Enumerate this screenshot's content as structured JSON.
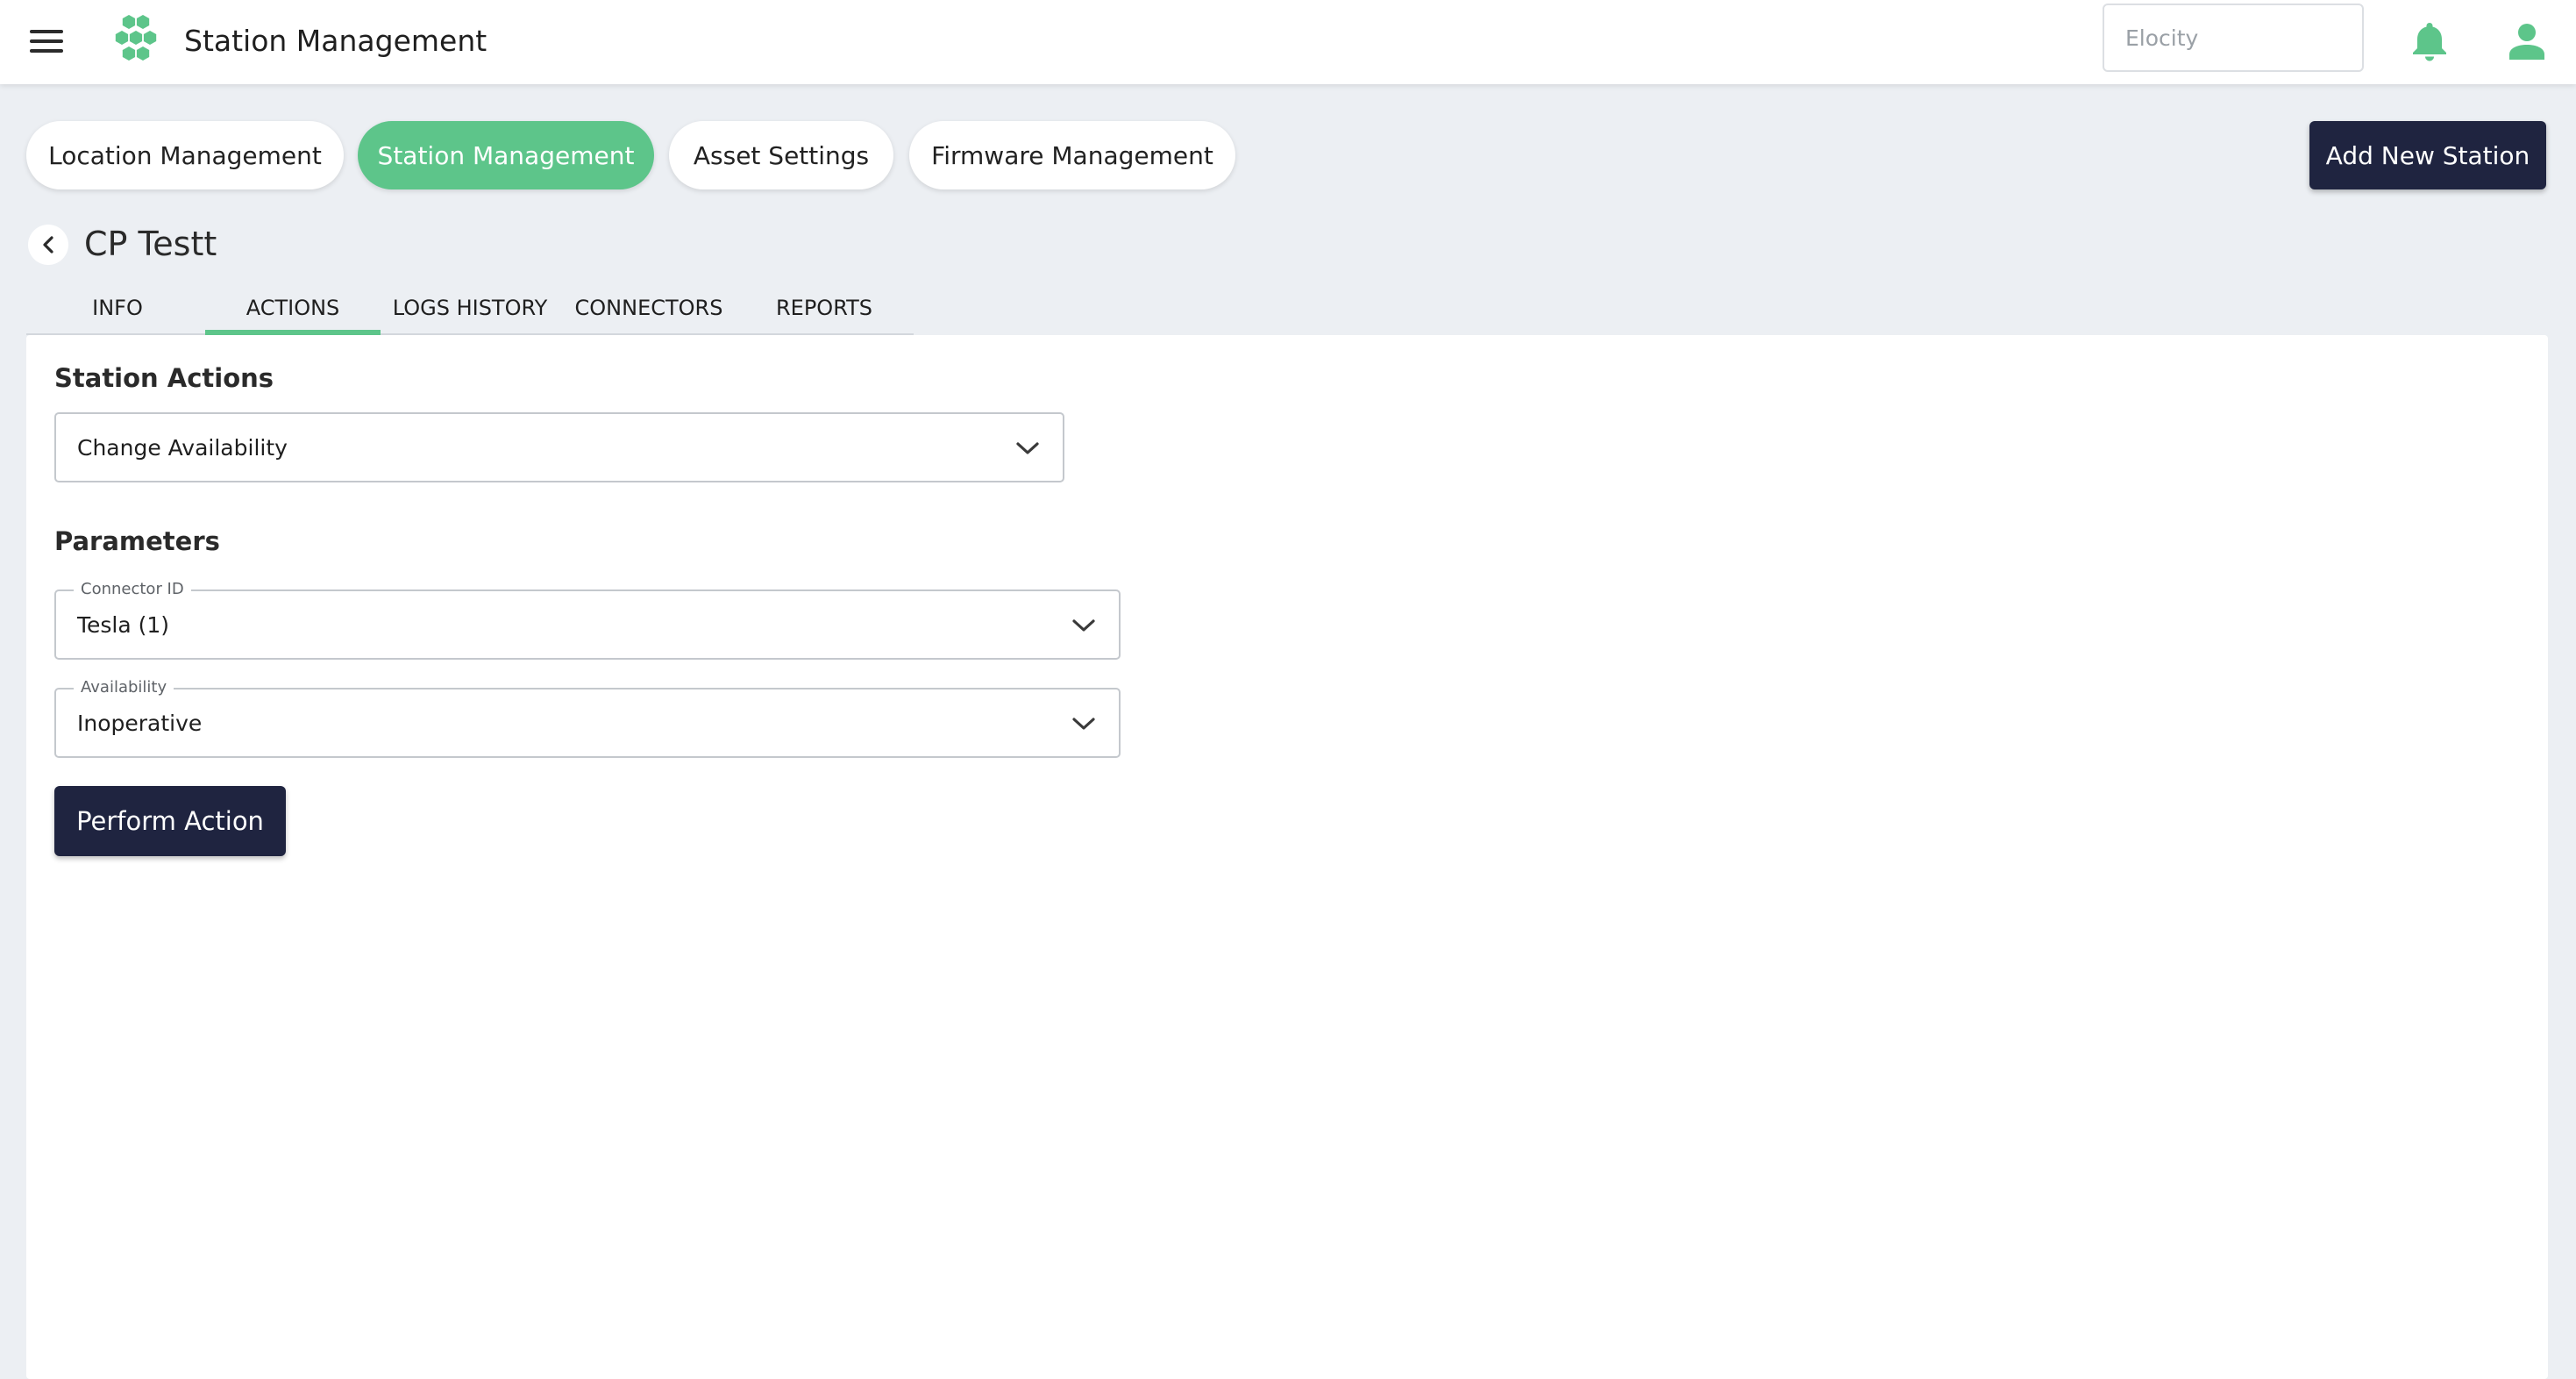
{
  "header": {
    "menu_icon": "hamburger-menu-icon",
    "logo_icon": "hexagon-cluster-logo",
    "title": "Station Management",
    "search": {
      "value": "",
      "placeholder": "Elocity"
    },
    "notification_icon": "bell-icon",
    "profile_icon": "user-icon"
  },
  "nav_pills": [
    {
      "label": "Location Management",
      "active": false
    },
    {
      "label": "Station Management",
      "active": true
    },
    {
      "label": "Asset Settings",
      "active": false
    },
    {
      "label": "Firmware Management",
      "active": false
    }
  ],
  "add_station_label": "Add New Station",
  "station": {
    "back_icon": "chevron-left-icon",
    "name": "CP Testt"
  },
  "tabs": [
    {
      "label": "INFO",
      "active": false
    },
    {
      "label": "ACTIONS",
      "active": true
    },
    {
      "label": "LOGS HISTORY",
      "active": false
    },
    {
      "label": "CONNECTORS",
      "active": false
    },
    {
      "label": "REPORTS",
      "active": false
    }
  ],
  "actions": {
    "section_title": "Station Actions",
    "selected_action": "Change Availability",
    "parameters_title": "Parameters",
    "connector": {
      "label": "Connector ID",
      "value": "Tesla (1)"
    },
    "availability": {
      "label": "Availability",
      "value": "Inoperative"
    },
    "submit_label": "Perform Action"
  },
  "colors": {
    "accent_green": "#5DC58A",
    "primary_dark": "#1F2440",
    "page_background": "#ECEFF3"
  }
}
